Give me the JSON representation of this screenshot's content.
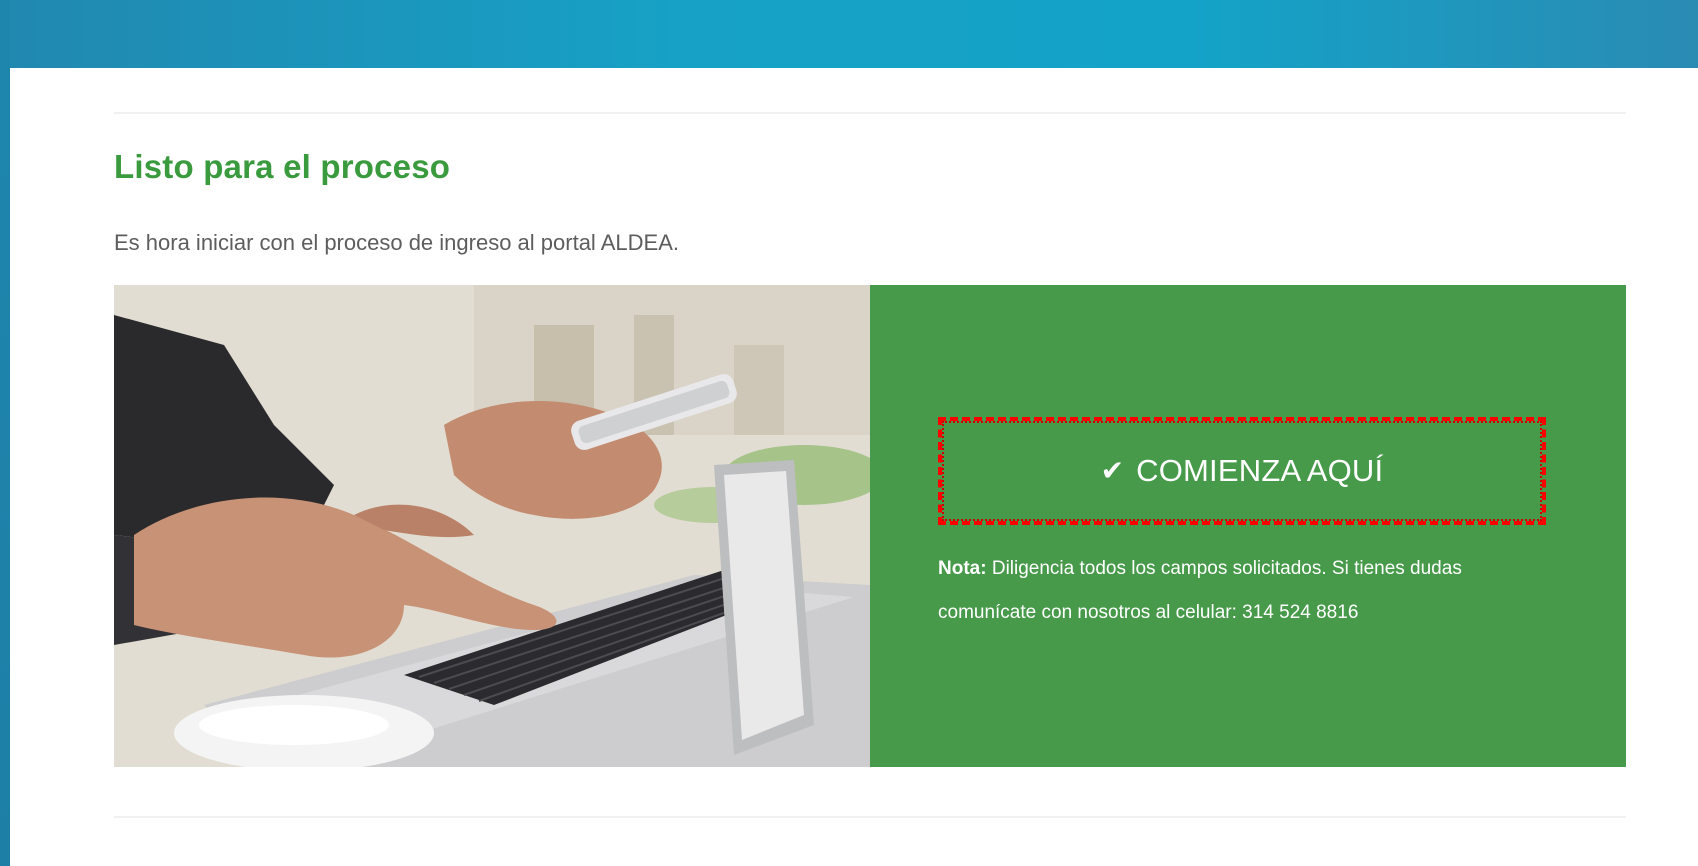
{
  "section": {
    "title": "Listo para el proceso",
    "subtitle": "Es hora iniciar con el proceso de ingreso al portal ALDEA."
  },
  "cta": {
    "icon": "check-icon",
    "icon_glyph": "✔",
    "label": "COMIENZA AQUÍ"
  },
  "note": {
    "label": "Nota:",
    "text": "Diligencia todos los campos solicitados. Si tienes dudas comunícate con nosotros al celular: 314 524 8816"
  },
  "colors": {
    "header_bar": "#17a1c6",
    "title_green": "#3a9a3e",
    "cta_background": "#479a4a",
    "highlight_border": "#ff0000"
  },
  "image": {
    "description_icon": "laptop-phone-photo"
  }
}
